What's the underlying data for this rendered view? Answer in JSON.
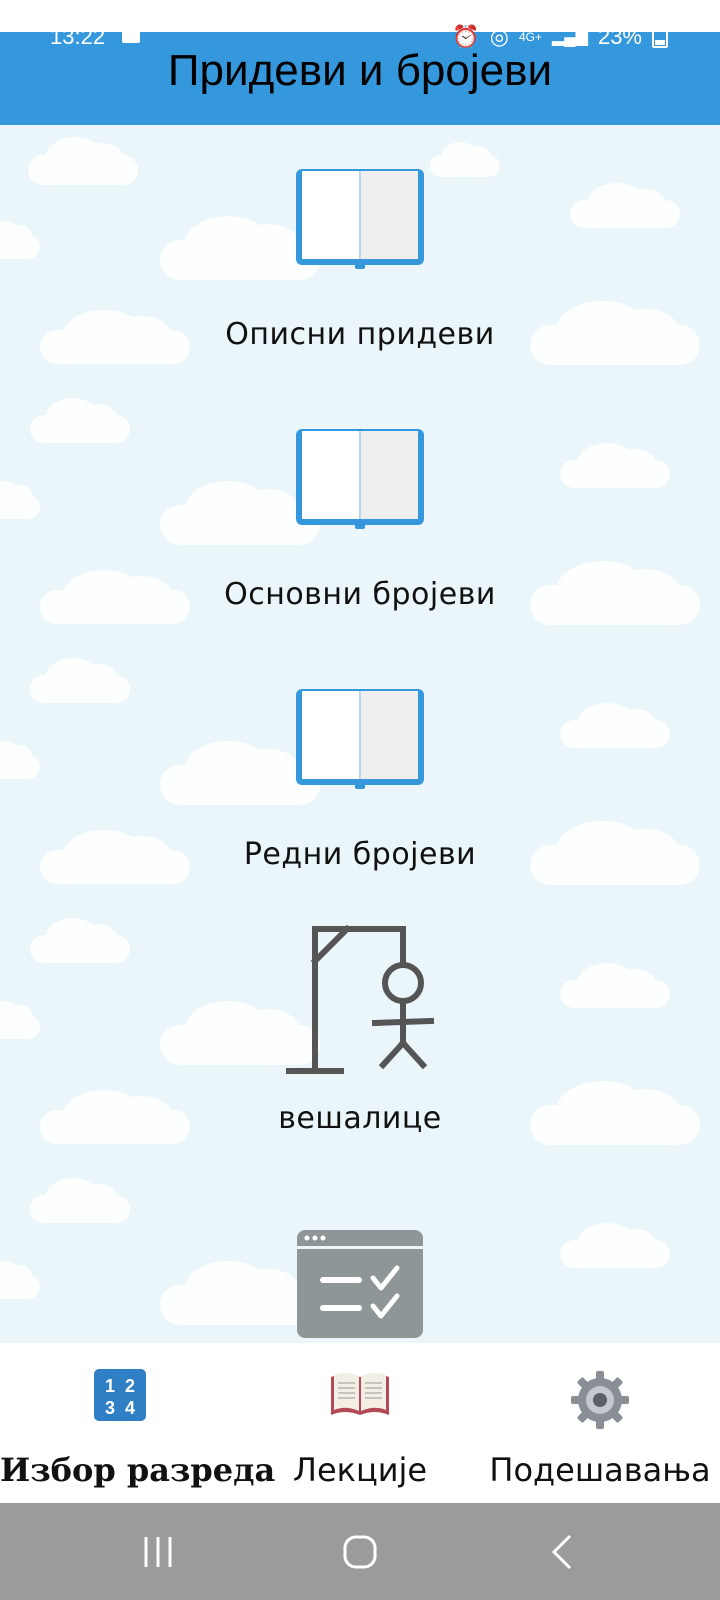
{
  "status_bar": {
    "time": "13:22",
    "battery": "23%",
    "network": "4G+"
  },
  "header": {
    "title": "Придеви и бројеви"
  },
  "lessons": [
    {
      "label": "Описни придеви",
      "icon": "book-icon"
    },
    {
      "label": "Основни бројеви",
      "icon": "book-icon"
    },
    {
      "label": "Редни бројеви",
      "icon": "book-icon"
    },
    {
      "label": "вешалице",
      "icon": "hangman-icon"
    },
    {
      "label": "",
      "icon": "quiz-checklist-icon"
    }
  ],
  "bottom_nav": {
    "items": [
      {
        "label": "Избор разреда",
        "icon": "number-grid-icon",
        "active": true
      },
      {
        "label": "Лекције",
        "icon": "open-book-icon",
        "active": false
      },
      {
        "label": "Подешавања",
        "icon": "gear-icon",
        "active": false
      }
    ]
  },
  "system_nav": {
    "buttons": [
      "recents-button",
      "home-button",
      "back-button"
    ]
  },
  "colors": {
    "appbar": "#3598dc",
    "content_bg": "#eaf6fa",
    "book_blue": "#3598dc",
    "system_bar": "#9b9b9b"
  }
}
